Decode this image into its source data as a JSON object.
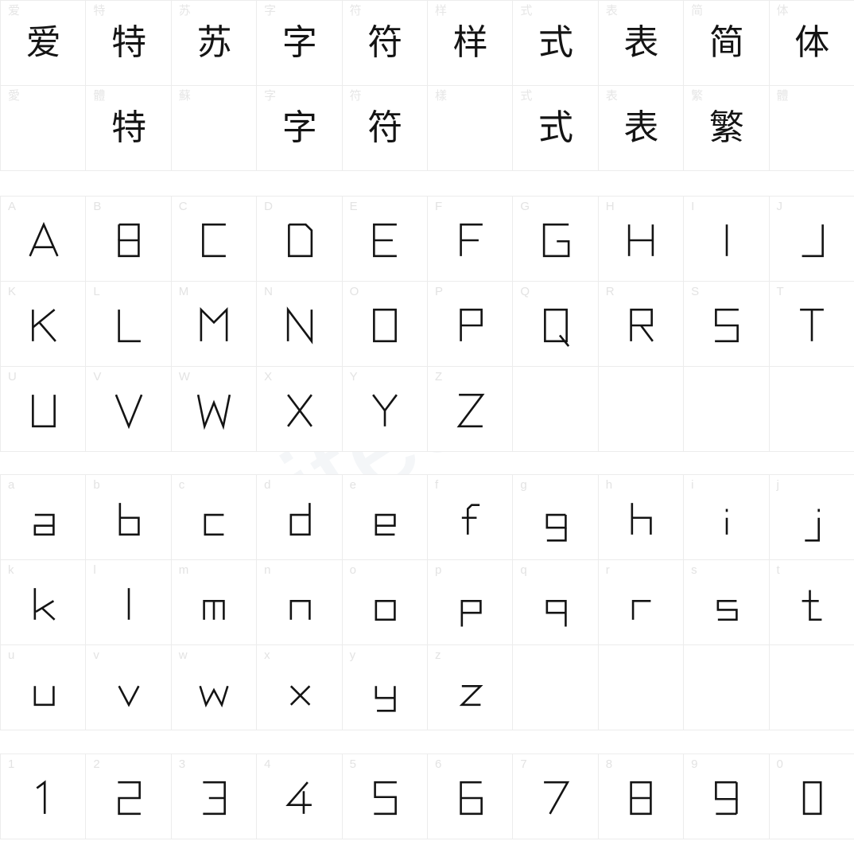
{
  "page": {
    "title": "Font specimen character map",
    "watermark": "aitesu.com",
    "background": "#ffffff",
    "grid_line_color": "#ececec",
    "corner_label_color": "#e3e3e3",
    "glyph_color": "#141414"
  },
  "sections": [
    {
      "name": "chinese-sample",
      "rows": [
        {
          "cells": [
            {
              "corner": "爱",
              "glyph": "爱",
              "kind": "cjk"
            },
            {
              "corner": "特",
              "glyph": "特",
              "kind": "cjk"
            },
            {
              "corner": "苏",
              "glyph": "苏",
              "kind": "cjk"
            },
            {
              "corner": "字",
              "glyph": "字",
              "kind": "cjk"
            },
            {
              "corner": "符",
              "glyph": "符",
              "kind": "cjk"
            },
            {
              "corner": "样",
              "glyph": "样",
              "kind": "cjk"
            },
            {
              "corner": "式",
              "glyph": "式",
              "kind": "cjk"
            },
            {
              "corner": "表",
              "glyph": "表",
              "kind": "cjk"
            },
            {
              "corner": "简",
              "glyph": "简",
              "kind": "cjk"
            },
            {
              "corner": "体",
              "glyph": "体",
              "kind": "cjk"
            }
          ]
        },
        {
          "cells": [
            {
              "corner": "愛",
              "glyph": "",
              "kind": "cjk"
            },
            {
              "corner": "體",
              "glyph": "特",
              "kind": "cjk"
            },
            {
              "corner": "蘇",
              "glyph": "",
              "kind": "cjk"
            },
            {
              "corner": "字",
              "glyph": "字",
              "kind": "cjk"
            },
            {
              "corner": "符",
              "glyph": "符",
              "kind": "cjk"
            },
            {
              "corner": "樣",
              "glyph": "",
              "kind": "cjk"
            },
            {
              "corner": "式",
              "glyph": "式",
              "kind": "cjk"
            },
            {
              "corner": "表",
              "glyph": "表",
              "kind": "cjk"
            },
            {
              "corner": "繁",
              "glyph": "繁",
              "kind": "cjk"
            },
            {
              "corner": "體",
              "glyph": "",
              "kind": "cjk"
            }
          ]
        }
      ]
    },
    {
      "name": "uppercase-latin",
      "rows": [
        {
          "cells": [
            {
              "corner": "A",
              "glyph": "A",
              "kind": "latin"
            },
            {
              "corner": "B",
              "glyph": "B",
              "kind": "latin"
            },
            {
              "corner": "C",
              "glyph": "C",
              "kind": "latin"
            },
            {
              "corner": "D",
              "glyph": "D",
              "kind": "latin"
            },
            {
              "corner": "E",
              "glyph": "E",
              "kind": "latin"
            },
            {
              "corner": "F",
              "glyph": "F",
              "kind": "latin"
            },
            {
              "corner": "G",
              "glyph": "G",
              "kind": "latin"
            },
            {
              "corner": "H",
              "glyph": "H",
              "kind": "latin"
            },
            {
              "corner": "I",
              "glyph": "I",
              "kind": "latin"
            },
            {
              "corner": "J",
              "glyph": "J",
              "kind": "latin"
            }
          ]
        },
        {
          "cells": [
            {
              "corner": "K",
              "glyph": "K",
              "kind": "latin"
            },
            {
              "corner": "L",
              "glyph": "L",
              "kind": "latin"
            },
            {
              "corner": "M",
              "glyph": "M",
              "kind": "latin"
            },
            {
              "corner": "N",
              "glyph": "N",
              "kind": "latin"
            },
            {
              "corner": "O",
              "glyph": "O",
              "kind": "latin"
            },
            {
              "corner": "P",
              "glyph": "P",
              "kind": "latin"
            },
            {
              "corner": "Q",
              "glyph": "Q",
              "kind": "latin"
            },
            {
              "corner": "R",
              "glyph": "R",
              "kind": "latin"
            },
            {
              "corner": "S",
              "glyph": "S",
              "kind": "latin"
            },
            {
              "corner": "T",
              "glyph": "T",
              "kind": "latin"
            }
          ]
        },
        {
          "cells": [
            {
              "corner": "U",
              "glyph": "U",
              "kind": "latin"
            },
            {
              "corner": "V",
              "glyph": "V",
              "kind": "latin"
            },
            {
              "corner": "W",
              "glyph": "W",
              "kind": "latin"
            },
            {
              "corner": "X",
              "glyph": "X",
              "kind": "latin"
            },
            {
              "corner": "Y",
              "glyph": "Y",
              "kind": "latin"
            },
            {
              "corner": "Z",
              "glyph": "Z",
              "kind": "latin"
            },
            {
              "corner": "",
              "glyph": "",
              "kind": "empty"
            },
            {
              "corner": "",
              "glyph": "",
              "kind": "empty"
            },
            {
              "corner": "",
              "glyph": "",
              "kind": "empty"
            },
            {
              "corner": "",
              "glyph": "",
              "kind": "empty"
            }
          ]
        }
      ]
    },
    {
      "name": "lowercase-latin",
      "rows": [
        {
          "cells": [
            {
              "corner": "a",
              "glyph": "a",
              "kind": "latin"
            },
            {
              "corner": "b",
              "glyph": "b",
              "kind": "latin"
            },
            {
              "corner": "c",
              "glyph": "c",
              "kind": "latin"
            },
            {
              "corner": "d",
              "glyph": "d",
              "kind": "latin"
            },
            {
              "corner": "e",
              "glyph": "e",
              "kind": "latin"
            },
            {
              "corner": "f",
              "glyph": "f",
              "kind": "latin"
            },
            {
              "corner": "g",
              "glyph": "g",
              "kind": "latin"
            },
            {
              "corner": "h",
              "glyph": "h",
              "kind": "latin"
            },
            {
              "corner": "i",
              "glyph": "i",
              "kind": "latin"
            },
            {
              "corner": "j",
              "glyph": "j",
              "kind": "latin"
            }
          ]
        },
        {
          "cells": [
            {
              "corner": "k",
              "glyph": "k",
              "kind": "latin"
            },
            {
              "corner": "l",
              "glyph": "l",
              "kind": "latin"
            },
            {
              "corner": "m",
              "glyph": "m",
              "kind": "latin"
            },
            {
              "corner": "n",
              "glyph": "n",
              "kind": "latin"
            },
            {
              "corner": "o",
              "glyph": "o",
              "kind": "latin"
            },
            {
              "corner": "p",
              "glyph": "p",
              "kind": "latin"
            },
            {
              "corner": "q",
              "glyph": "q",
              "kind": "latin"
            },
            {
              "corner": "r",
              "glyph": "r",
              "kind": "latin"
            },
            {
              "corner": "s",
              "glyph": "s",
              "kind": "latin"
            },
            {
              "corner": "t",
              "glyph": "t",
              "kind": "latin"
            }
          ]
        },
        {
          "cells": [
            {
              "corner": "u",
              "glyph": "u",
              "kind": "latin"
            },
            {
              "corner": "v",
              "glyph": "v",
              "kind": "latin"
            },
            {
              "corner": "w",
              "glyph": "w",
              "kind": "latin"
            },
            {
              "corner": "x",
              "glyph": "x",
              "kind": "latin"
            },
            {
              "corner": "y",
              "glyph": "y",
              "kind": "latin"
            },
            {
              "corner": "z",
              "glyph": "z",
              "kind": "latin"
            },
            {
              "corner": "",
              "glyph": "",
              "kind": "empty"
            },
            {
              "corner": "",
              "glyph": "",
              "kind": "empty"
            },
            {
              "corner": "",
              "glyph": "",
              "kind": "empty"
            },
            {
              "corner": "",
              "glyph": "",
              "kind": "empty"
            }
          ]
        }
      ]
    },
    {
      "name": "digits",
      "rows": [
        {
          "cells": [
            {
              "corner": "1",
              "glyph": "1",
              "kind": "latin"
            },
            {
              "corner": "2",
              "glyph": "2",
              "kind": "latin"
            },
            {
              "corner": "3",
              "glyph": "3",
              "kind": "latin"
            },
            {
              "corner": "4",
              "glyph": "4",
              "kind": "latin"
            },
            {
              "corner": "5",
              "glyph": "5",
              "kind": "latin"
            },
            {
              "corner": "6",
              "glyph": "6",
              "kind": "latin"
            },
            {
              "corner": "7",
              "glyph": "7",
              "kind": "latin"
            },
            {
              "corner": "8",
              "glyph": "8",
              "kind": "latin"
            },
            {
              "corner": "9",
              "glyph": "9",
              "kind": "latin"
            },
            {
              "corner": "0",
              "glyph": "0",
              "kind": "latin"
            }
          ]
        }
      ]
    }
  ]
}
